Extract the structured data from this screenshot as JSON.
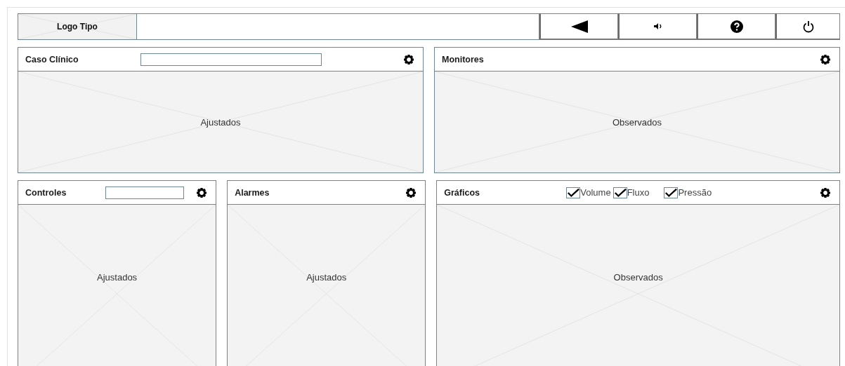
{
  "header": {
    "logo": "Logo Tipo",
    "buttons": [
      {
        "kind": "back"
      },
      {
        "kind": "sound"
      },
      {
        "kind": "help"
      },
      {
        "kind": "power"
      }
    ]
  },
  "rows": [
    [
      {
        "title": "Caso Clínico",
        "kind": "field",
        "body": "Ajustados"
      },
      {
        "title": "Monitores",
        "kind": "plain",
        "body": "Observados"
      }
    ],
    [
      {
        "title": "Controles",
        "kind": "field",
        "body": "Ajustados"
      },
      {
        "title": "Alarmes",
        "kind": "plain",
        "body": "Ajustados"
      },
      {
        "title": "Gráficos",
        "kind": "checkboxes",
        "body": "Observados",
        "checkboxes": [
          {
            "label": "Volume",
            "checked": true
          },
          {
            "label": "Fluxo",
            "checked": true
          },
          {
            "label": "Pressão",
            "checked": true
          }
        ]
      }
    ]
  ]
}
